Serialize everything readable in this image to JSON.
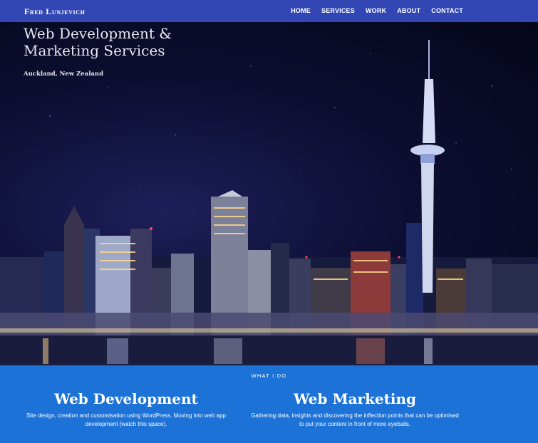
{
  "nav": {
    "brand": "Fred Lunjevich",
    "items": [
      "HOME",
      "SERVICES",
      "WORK",
      "ABOUT",
      "CONTACT"
    ]
  },
  "hero": {
    "title": "Web Development & Marketing Services",
    "subtitle": "Auckland, New Zealand"
  },
  "services": {
    "section_label": "WHAT I DO",
    "items": [
      {
        "title": "Web Development",
        "description": "Site design, creation and customisation using WordPress. Moving into web app development (watch this space)."
      },
      {
        "title": "Web Marketing",
        "description": "Gathering data, insights and discovering the inflection points that can be optimised to put your content in front of more eyeballs."
      }
    ]
  },
  "colors": {
    "nav_background": "#3347b4",
    "services_background": "#1d72d8",
    "hero_night_sky": "#0d0f33"
  }
}
